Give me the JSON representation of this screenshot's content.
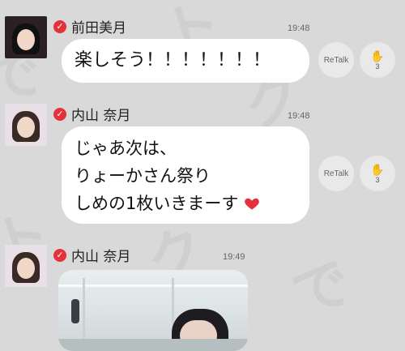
{
  "messages": [
    {
      "author": "前田美月",
      "time": "19:48",
      "lines": [
        "楽しそう！！！！！！！"
      ],
      "retalk_label": "ReTalk",
      "clap_count": "3"
    },
    {
      "author": "内山 奈月",
      "time": "19:48",
      "lines": [
        "じゃあ次は、",
        "りょーかさん祭り",
        "しめの1枚いきまーす"
      ],
      "retalk_label": "ReTalk",
      "clap_count": "3"
    },
    {
      "author": "内山 奈月",
      "time": "19:49"
    }
  ],
  "icons": {
    "verified": "check-badge",
    "clap": "clap-hands",
    "heart": "red-heart"
  },
  "colors": {
    "background": "#d9d9d9",
    "verified": "#e4323b",
    "bubble": "#ffffff"
  }
}
